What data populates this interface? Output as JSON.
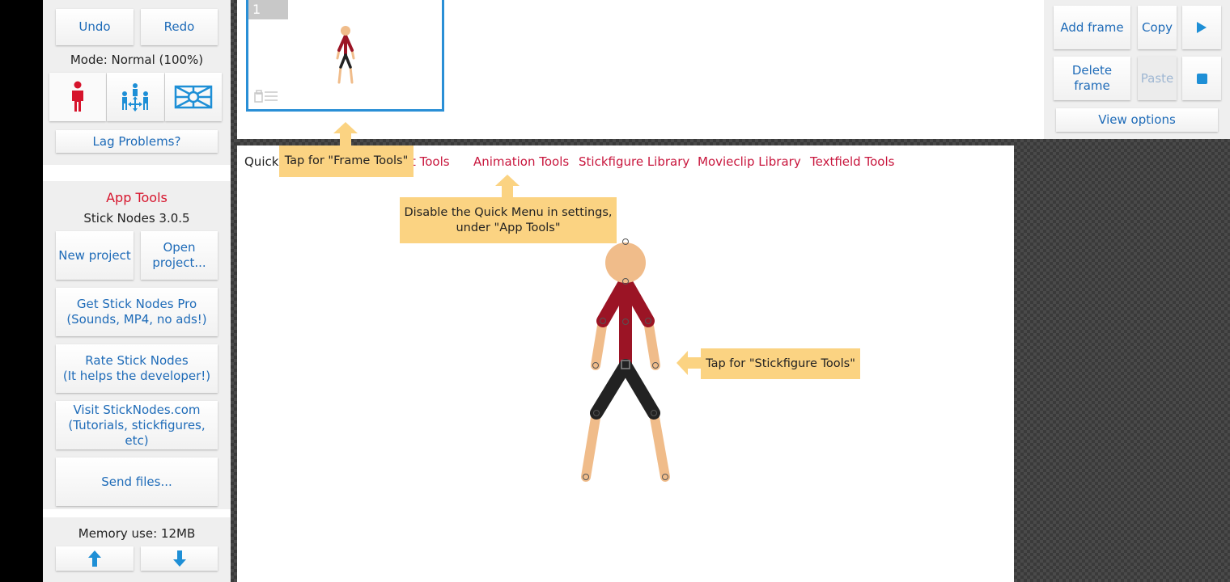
{
  "sidebar": {
    "undo": "Undo",
    "redo": "Redo",
    "mode": "Mode: Normal (100%)",
    "mode_buttons": [
      "stickfigure-mode",
      "group-move-mode",
      "camera-mode"
    ],
    "lag": "Lag Problems?",
    "app_tools_title": "App Tools",
    "version": "Stick Nodes 3.0.5",
    "new_project": "New project",
    "open_project_1": "Open",
    "open_project_2": "project...",
    "pro_1": "Get Stick Nodes Pro",
    "pro_2": "(Sounds, MP4, no ads!)",
    "rate_1": "Rate Stick Nodes",
    "rate_2": "(It helps the developer!)",
    "visit_1": "Visit StickNodes.com",
    "visit_2": "(Tutorials, stickfigures, etc)",
    "send": "Send files...",
    "memory": "Memory use: 12MB"
  },
  "frames": {
    "items": [
      {
        "number": "1"
      }
    ]
  },
  "right_panel": {
    "add_frame": "Add frame",
    "copy": "Copy",
    "delete_frame": "Delete frame",
    "paste": "Paste",
    "view_options": "View options"
  },
  "quick_menu": {
    "items": [
      "Quick",
      "Object Tools",
      "Animation Tools",
      "Stickfigure Library",
      "Movieclip Library",
      "Textfield Tools"
    ]
  },
  "tips": {
    "frame_tools": "Tap for \"Frame Tools\"",
    "quick_menu_1": "Disable the Quick Menu in settings,",
    "quick_menu_2": "under \"App Tools\"",
    "stickfigure_tools": "Tap for \"Stickfigure Tools\""
  },
  "colors": {
    "accent_blue": "#1e6bb8",
    "accent_red": "#c8163d",
    "tip_bg": "#fbd382",
    "skin": "#f0bc8a",
    "shirt": "#9b1425",
    "pants": "#222222"
  }
}
